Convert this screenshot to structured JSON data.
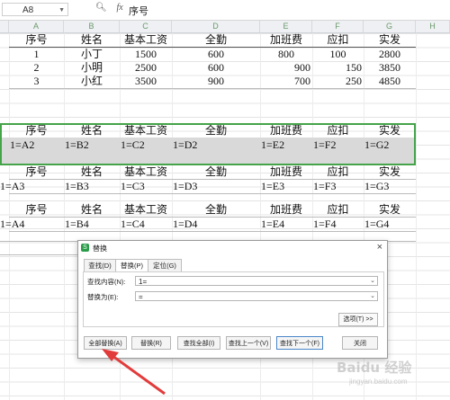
{
  "formula_bar": {
    "name_box": "A8",
    "formula": "序号",
    "zoom_icon": "magnifier-icon",
    "fx_label": "fx"
  },
  "columns": [
    "A",
    "B",
    "C",
    "D",
    "E",
    "F",
    "G",
    "H"
  ],
  "table1": {
    "headers": [
      "序号",
      "姓名",
      "基本工资",
      "全勤",
      "加班费",
      "应扣",
      "实发"
    ],
    "rows": [
      [
        "1",
        "小丁",
        "1500",
        "600",
        "800",
        "100",
        "2800"
      ],
      [
        "2",
        "小明",
        "2500",
        "600",
        "900",
        "150",
        "3850"
      ],
      [
        "3",
        "小红",
        "3500",
        "900",
        "700",
        "250",
        "4850"
      ]
    ]
  },
  "blocks": [
    {
      "headers": [
        "序号",
        "姓名",
        "基本工资",
        "全勤",
        "加班费",
        "应扣",
        "实发"
      ],
      "refs": [
        "1=A2",
        "1=B2",
        "1=C2",
        "1=D2",
        "1=E2",
        "1=F2",
        "1=G2"
      ]
    },
    {
      "headers": [
        "序号",
        "姓名",
        "基本工资",
        "全勤",
        "加班费",
        "应扣",
        "实发"
      ],
      "refs": [
        "1=A3",
        "1=B3",
        "1=C3",
        "1=D3",
        "1=E3",
        "1=F3",
        "1=G3"
      ]
    },
    {
      "headers": [
        "序号",
        "姓名",
        "基本工资",
        "全勤",
        "加班费",
        "应扣",
        "实发"
      ],
      "refs": [
        "1=A4",
        "1=B4",
        "1=C4",
        "1=D4",
        "1=E4",
        "1=F4",
        "1=G4"
      ]
    }
  ],
  "dialog": {
    "title": "替换",
    "tabs": [
      "查找(D)",
      "替换(P)",
      "定位(G)"
    ],
    "find_label": "查找内容(N):",
    "find_value": "1=",
    "replace_label": "替换为(E):",
    "replace_value": "=",
    "options_button": "选项(T) >>",
    "buttons": [
      "全部替换(A)",
      "替换(R)",
      "查找全部(I)",
      "查找上一个(V)",
      "查找下一个(F)",
      "关闭"
    ]
  },
  "watermark": {
    "main": "Baidu 经验",
    "sub": "jingyan.baidu.com"
  },
  "colors": {
    "accent_green": "#45a34a",
    "dialog_primary": "#4a86c8",
    "arrow": "#e23b3b"
  }
}
